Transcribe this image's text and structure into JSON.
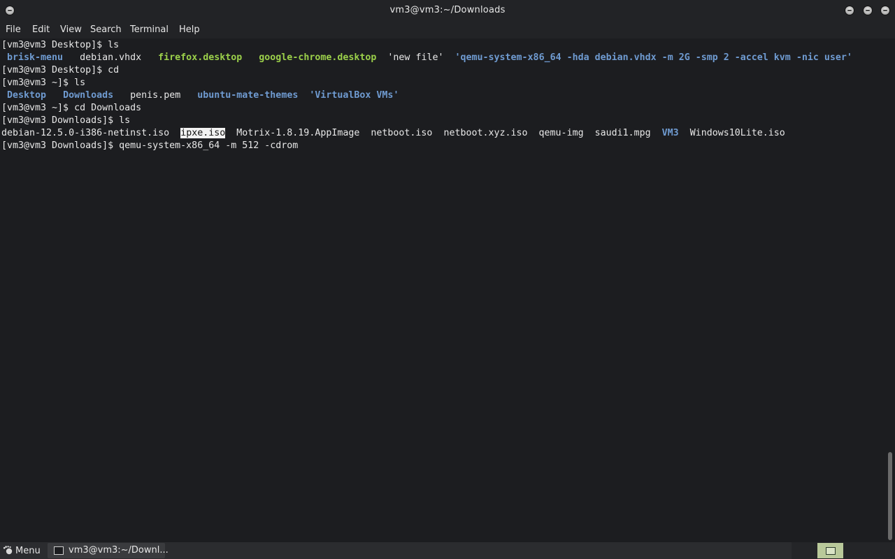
{
  "window": {
    "title": "vm3@vm3:~/Downloads"
  },
  "menubar": {
    "file": "File",
    "edit": "Edit",
    "view": "View",
    "search": "Search",
    "terminal": "Terminal",
    "help": "Help"
  },
  "terminal": {
    "lines": [
      [
        {
          "text": "[vm3@vm3 Desktop]$ ls",
          "style": "plain"
        }
      ],
      [
        {
          "text": " brisk-menu",
          "style": "blue"
        },
        {
          "text": "   debian.vhdx   ",
          "style": "plain"
        },
        {
          "text": "firefox.desktop",
          "style": "green"
        },
        {
          "text": "   ",
          "style": "plain"
        },
        {
          "text": "google-chrome.desktop",
          "style": "green"
        },
        {
          "text": "  'new file'  ",
          "style": "plain"
        },
        {
          "text": "'qemu-system-x86_64 -hda debian.vhdx -m 2G -smp 2 -accel kvm -nic user'",
          "style": "blue"
        }
      ],
      [
        {
          "text": "[vm3@vm3 Desktop]$ cd",
          "style": "plain"
        }
      ],
      [
        {
          "text": "[vm3@vm3 ~]$ ls",
          "style": "plain"
        }
      ],
      [
        {
          "text": " Desktop",
          "style": "blue"
        },
        {
          "text": "   ",
          "style": "plain"
        },
        {
          "text": "Downloads",
          "style": "blue"
        },
        {
          "text": "   penis.pem   ",
          "style": "plain"
        },
        {
          "text": "ubuntu-mate-themes",
          "style": "blue"
        },
        {
          "text": "  ",
          "style": "plain"
        },
        {
          "text": "'VirtualBox VMs'",
          "style": "blue"
        }
      ],
      [
        {
          "text": "[vm3@vm3 ~]$ cd Downloads",
          "style": "plain"
        }
      ],
      [
        {
          "text": "[vm3@vm3 Downloads]$ ls",
          "style": "plain"
        }
      ],
      [
        {
          "text": "debian-12.5.0-i386-netinst.iso  ",
          "style": "plain"
        },
        {
          "text": "ipxe.iso",
          "style": "sel"
        },
        {
          "text": "  Motrix-1.8.19.AppImage  netboot.iso  netboot.xyz.iso  qemu-img  saudi1.mpg  ",
          "style": "plain"
        },
        {
          "text": "VM3",
          "style": "blue"
        },
        {
          "text": "  Windows10Lite.iso",
          "style": "plain"
        }
      ],
      [
        {
          "text": "[vm3@vm3 Downloads]$ qemu-system-x86_64 -m 512 -cdrom ",
          "style": "plain"
        }
      ]
    ]
  },
  "taskbar": {
    "menu_label": "Menu",
    "task_label": "vm3@vm3:~/Downl..."
  }
}
